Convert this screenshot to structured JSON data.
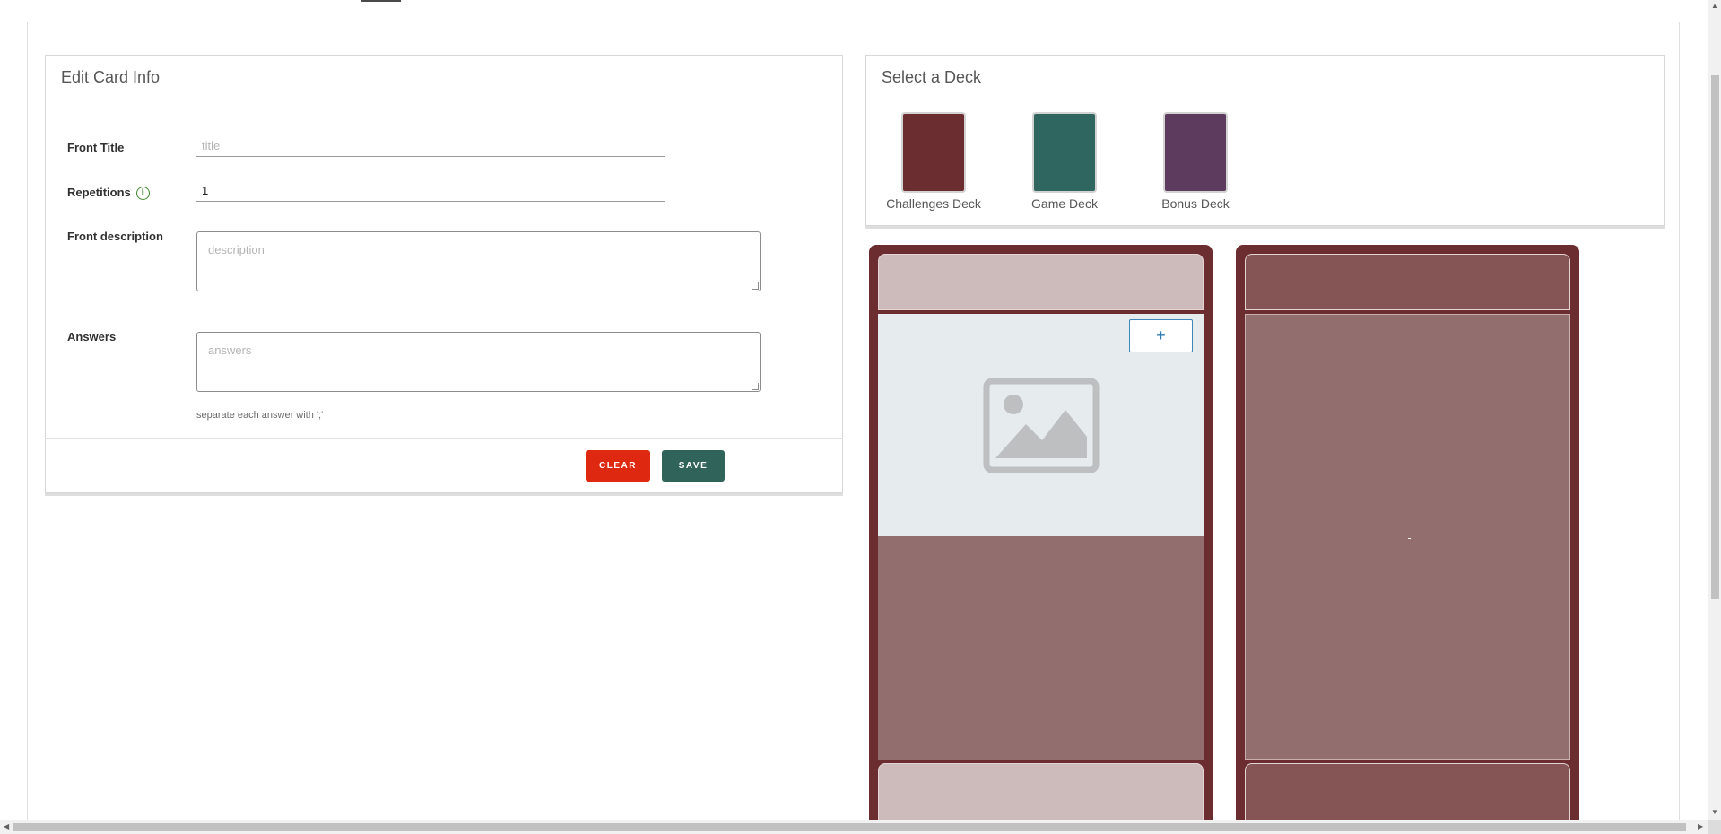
{
  "edit_card": {
    "title": "Edit Card Info",
    "front_title_label": "Front Title",
    "front_title_placeholder": "title",
    "front_title_value": "",
    "repetitions_label": "Repetitions",
    "repetitions_value": "1",
    "front_description_label": "Front description",
    "front_description_placeholder": "description",
    "answers_label": "Answers",
    "answers_placeholder": "answers",
    "answers_hint": "separate each answer with ';'",
    "clear_label": "CLEAR",
    "save_label": "SAVE"
  },
  "deck_select": {
    "title": "Select a Deck",
    "decks": [
      {
        "name": "Challenges Deck",
        "color": "#6b2d30"
      },
      {
        "name": "Game Deck",
        "color": "#2f6660"
      },
      {
        "name": "Bonus Deck",
        "color": "#5d3b5f"
      }
    ]
  },
  "card_front": {
    "add_image_label": "+",
    "frame_color": "#6b2d30",
    "header_color": "#cdbbbb",
    "image_bg": "#e6ebed",
    "body_color": "#926f6e"
  },
  "card_back": {
    "frame_color": "#6b2d30",
    "header_color": "#855555",
    "body_color": "#926f6e",
    "center_text": "-"
  }
}
